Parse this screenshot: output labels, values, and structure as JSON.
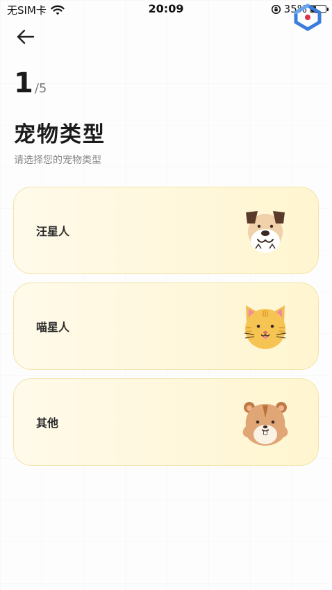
{
  "status_bar": {
    "carrier": "无SIM卡",
    "time": "20:09",
    "battery": "35%",
    "battery_level": 0.35,
    "icons": [
      "wifi-icon",
      "screen-lock-rotation-icon",
      "battery-icon"
    ]
  },
  "nav": {
    "back_icon": "arrow-left-icon"
  },
  "step": {
    "current": "1",
    "total": "/5"
  },
  "title": "宠物类型",
  "subtitle": "请选择您的宠物类型",
  "options": [
    {
      "label": "汪星人",
      "icon": "dog-icon"
    },
    {
      "label": "喵星人",
      "icon": "cat-icon"
    },
    {
      "label": "其他",
      "icon": "hamster-icon"
    }
  ],
  "colors": {
    "card_start": "#fffaea",
    "card_end": "#fff5d0",
    "card_border": "#f3e3a8"
  }
}
